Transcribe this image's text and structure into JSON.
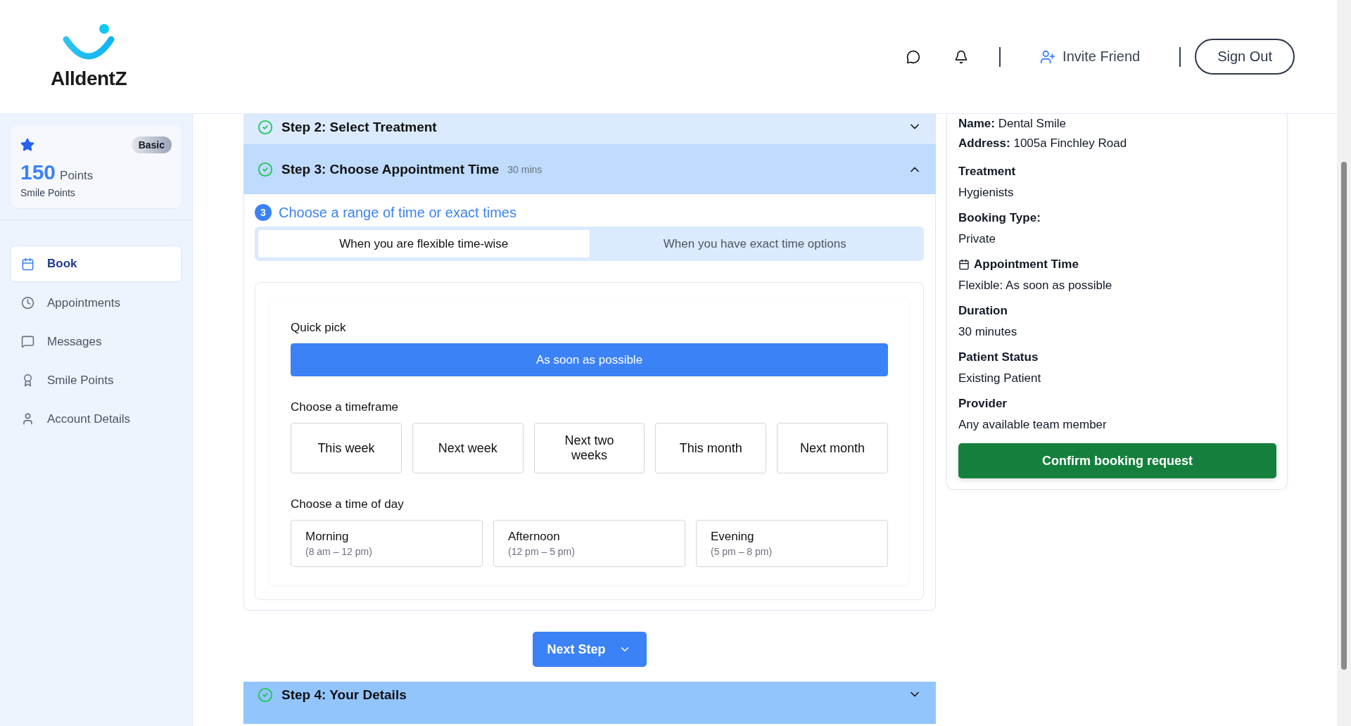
{
  "brand": {
    "name": "AlldentZ"
  },
  "header": {
    "invite": "Invite Friend",
    "sign_out": "Sign Out"
  },
  "points_card": {
    "tier": "Basic",
    "points": "150",
    "unit": "Points",
    "caption": "Smile Points"
  },
  "sidebar": {
    "items": [
      {
        "label": "Book",
        "selected": true
      },
      {
        "label": "Appointments",
        "selected": false
      },
      {
        "label": "Messages",
        "selected": false
      },
      {
        "label": "Smile Points",
        "selected": false
      },
      {
        "label": "Account Details",
        "selected": false
      }
    ]
  },
  "steps_before": [
    {
      "title": "Step 2: Select Treatment",
      "done": true,
      "expanded": false,
      "hovered": false
    },
    {
      "title": "Step 3: Choose Appointment Time",
      "meta": "30 mins",
      "done": true,
      "expanded": true,
      "hovered": false
    }
  ],
  "step_panel": {
    "number": "3",
    "heading": "Choose a range of time or exact times",
    "tabs": [
      {
        "label": "When you are flexible time-wise",
        "selected": true
      },
      {
        "label": "When you have exact time options",
        "selected": false
      }
    ],
    "quick_pick": {
      "label": "Quick pick",
      "options": [
        {
          "label": "As soon as possible",
          "selected": true
        }
      ]
    },
    "timeframe": {
      "label": "Choose a timeframe",
      "options": [
        {
          "label": "This week",
          "selected": false
        },
        {
          "label": "Next week",
          "selected": false
        },
        {
          "label": "Next two weeks",
          "selected": false
        },
        {
          "label": "This month",
          "selected": false
        },
        {
          "label": "Next month",
          "selected": false
        }
      ]
    },
    "time_of_day": {
      "label": "Choose a time of day",
      "options": [
        {
          "label": "Morning",
          "range": "(8 am – 12 pm)",
          "selected": false
        },
        {
          "label": "Afternoon",
          "range": "(12 pm – 5 pm)",
          "selected": false
        },
        {
          "label": "Evening",
          "range": "(5 pm – 8 pm)",
          "selected": false
        }
      ]
    }
  },
  "next_button": "Next Step",
  "steps_after": [
    {
      "title": "Step 4: Your Details",
      "done": true,
      "expanded": false,
      "hovered": true
    }
  ],
  "summary": {
    "rows": [
      {
        "kind": "inline",
        "label": "Name:",
        "value": "Dental Smile"
      },
      {
        "kind": "inline",
        "label": "Address:",
        "value": "1005a Finchley Road"
      },
      {
        "kind": "stacked",
        "label": "Treatment",
        "value": "Hygienists"
      },
      {
        "kind": "stacked",
        "label": "Booking Type:",
        "value": "Private"
      },
      {
        "kind": "dated",
        "label": "Appointment Time",
        "value": "Flexible: As soon as possible"
      },
      {
        "kind": "stacked",
        "label": "Duration",
        "value": "30 minutes"
      },
      {
        "kind": "stacked",
        "label": "Patient Status",
        "value": "Existing Patient"
      },
      {
        "kind": "stacked",
        "label": "Provider",
        "value": "Any available team member"
      }
    ],
    "confirm": "Confirm booking request"
  }
}
